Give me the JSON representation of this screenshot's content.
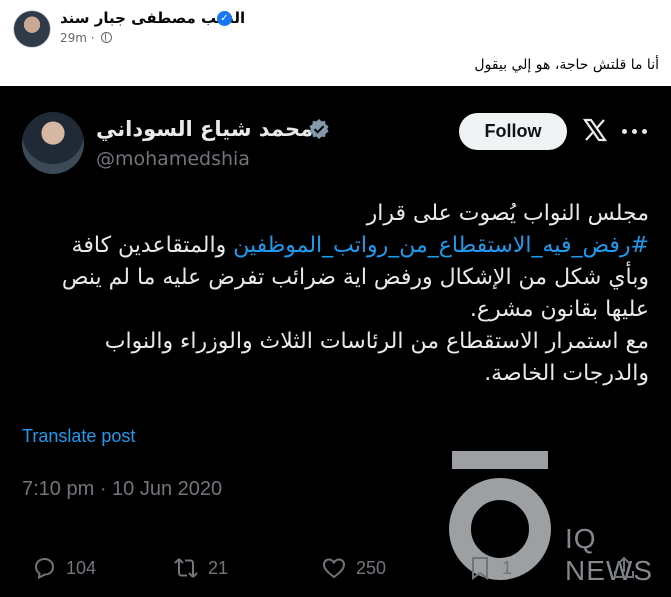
{
  "facebook": {
    "author_name": "النائب مصطفى جبار سند",
    "time": "29m",
    "dot": "·",
    "caption": "أنا ما قلتش حاجة، هو إلي بيقول"
  },
  "tweet": {
    "author_name": "محمد شياع السوداني",
    "handle": "@mohamedshia",
    "follow_label": "Follow",
    "body": {
      "line1": "مجلس النواب يُصوت على قرار",
      "hashtag": "#رفض_فيه_الاستقطاع_من_رواتب_الموظفين",
      "line2_rest": " والمتقاعدين كافة",
      "line3": "وبأي شكل من الإشكال ورفض اية ضرائب تفرض عليه ما لم ينص",
      "line4": "عليها بقانون مشرع.",
      "line5": "مع استمرار الاستقطاع من الرئاسات الثلاث والوزراء والنواب",
      "line6": "والدرجات الخاصة."
    },
    "translate_label": "Translate post",
    "timestamp": "7:10 pm · 10 Jun 2020",
    "actions": {
      "replies": "104",
      "reposts": "21",
      "likes": "250",
      "bookmarks": "1"
    },
    "watermark": "IQ NEWS"
  },
  "colors": {
    "fb_blue": "#1877f2",
    "x_blue": "#1d9bf0",
    "tweet_bg": "#000000",
    "muted": "#71767b"
  }
}
